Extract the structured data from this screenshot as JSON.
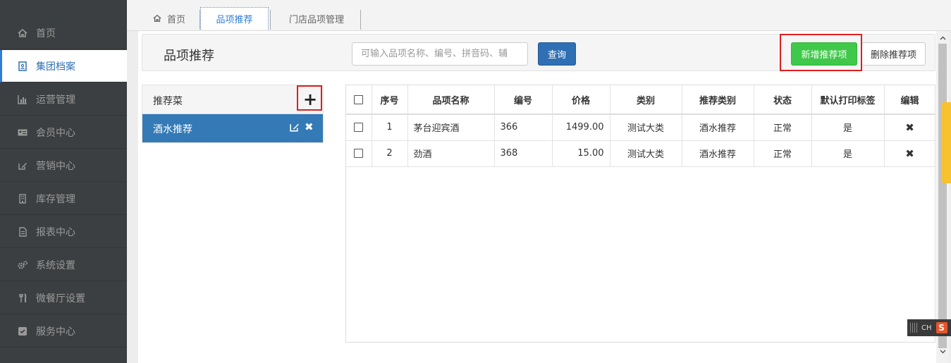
{
  "sidebar": {
    "items": [
      {
        "label": "首页",
        "icon": "home-icon"
      },
      {
        "label": "集团档案",
        "icon": "archive-icon",
        "active": true
      },
      {
        "label": "运营管理",
        "icon": "bar-chart-icon"
      },
      {
        "label": "会员中心",
        "icon": "member-card-icon"
      },
      {
        "label": "营销中心",
        "icon": "edit-icon"
      },
      {
        "label": "库存管理",
        "icon": "building-icon"
      },
      {
        "label": "报表中心",
        "icon": "report-icon"
      },
      {
        "label": "系统设置",
        "icon": "gears-icon"
      },
      {
        "label": "微餐厅设置",
        "icon": "cutlery-icon"
      },
      {
        "label": "服务中心",
        "icon": "service-icon"
      }
    ]
  },
  "tabs": [
    {
      "label": "首页",
      "icon": "home-icon"
    },
    {
      "label": "品项推荐",
      "active": true
    },
    {
      "label": "门店品项管理"
    }
  ],
  "header": {
    "title": "品项推荐",
    "search_placeholder": "可输入品项名称、编号、拼音码、辅",
    "query_label": "查询",
    "add_label": "新增推荐项",
    "delete_label": "删除推荐项"
  },
  "list": {
    "header": "推荐菜",
    "add_symbol": "+",
    "items": [
      {
        "label": "酒水推荐"
      }
    ]
  },
  "table": {
    "columns": [
      "序号",
      "品项名称",
      "编号",
      "价格",
      "类别",
      "推荐类别",
      "状态",
      "默认打印标签",
      "编辑"
    ],
    "rows": [
      {
        "index": "1",
        "name": "茅台迎宾酒",
        "code": "366",
        "price": "1499.00",
        "category": "测试大类",
        "rec_category": "酒水推荐",
        "status": "正常",
        "print_label": "是",
        "edit": "✖"
      },
      {
        "index": "2",
        "name": "劲酒",
        "code": "368",
        "price": "15.00",
        "category": "测试大类",
        "rec_category": "酒水推荐",
        "status": "正常",
        "print_label": "是",
        "edit": "✖"
      }
    ]
  },
  "ime": {
    "label": "CH",
    "logo": "S"
  },
  "colors": {
    "sidebar_bg": "#3c3f41",
    "primary": "#337ab7",
    "add_button": "#3fc84a",
    "highlight_box": "#e01f1f",
    "side_tab": "#f7c22e"
  }
}
